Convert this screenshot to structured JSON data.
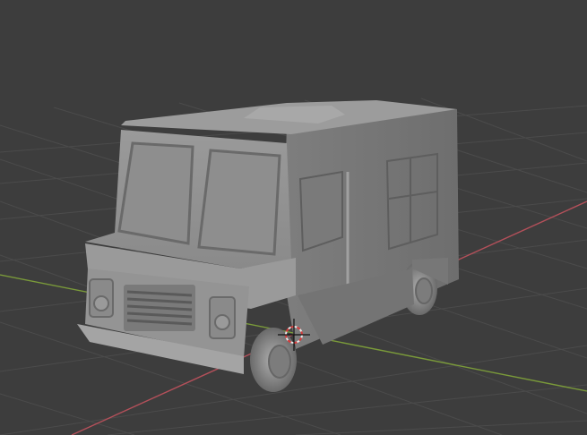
{
  "viewport": {
    "mode": "solid-shading",
    "object_name": "",
    "background_color": "#3d3d3d",
    "grid_color": "#4a4a4a",
    "x_axis_color": "#b4505a",
    "y_axis_color": "#7a9a3a",
    "model_color": "#8c8c8c",
    "cursor_icon": "3d-cursor-icon"
  }
}
